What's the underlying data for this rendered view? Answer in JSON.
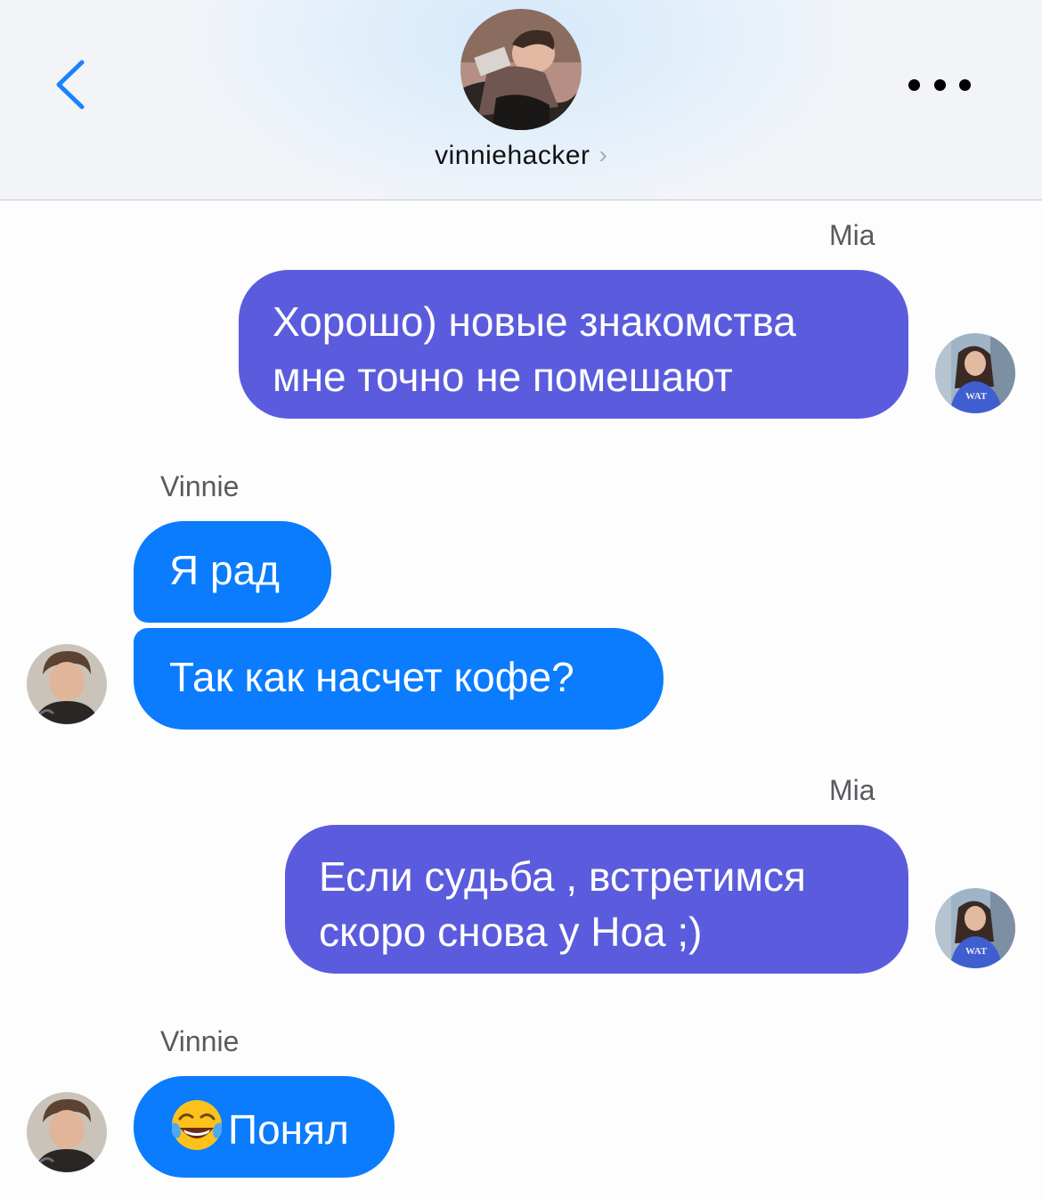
{
  "header": {
    "contact_name": "vinniehacker",
    "chevron": "›",
    "back_icon": "chevron-left-icon",
    "more_icon": "more-dots-icon",
    "accent_color": "#0a7cfd"
  },
  "messages": [
    {
      "sender": "Mia",
      "direction": "outgoing",
      "lines": [
        "Хорошо) новые знакомства",
        "мне точно не помешают"
      ]
    },
    {
      "sender": "Vinnie",
      "direction": "incoming",
      "lines": [
        "Я рад"
      ]
    },
    {
      "direction": "incoming",
      "lines": [
        "Так как насчет кофе?"
      ]
    },
    {
      "sender": "Mia",
      "direction": "outgoing",
      "lines": [
        "Если судьба , встретимся",
        "скоро снова у Ноа ;)"
      ]
    },
    {
      "sender": "Vinnie",
      "direction": "incoming",
      "emoji": "face-with-tears-of-joy-icon",
      "lines": [
        "Понял"
      ]
    }
  ],
  "colors": {
    "outgoing_bubble": "#5b5cdd",
    "incoming_bubble": "#0a7cfd",
    "bubble_text": "#ffffff",
    "sender_label": "#5a5a5f"
  }
}
